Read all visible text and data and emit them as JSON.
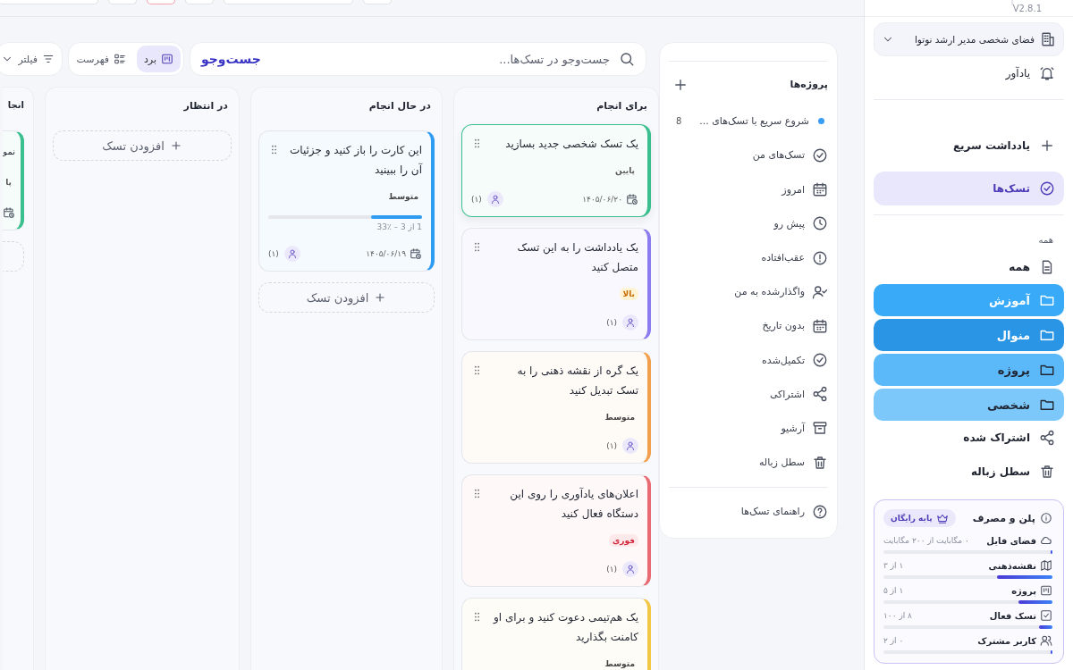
{
  "top_toolbar": {
    "buttons": [
      {
        "kind": "small",
        "selected": false
      },
      {
        "kind": "long",
        "selected": false
      },
      {
        "kind": "small",
        "selected": false
      },
      {
        "kind": "small",
        "selected": true
      },
      {
        "kind": "small",
        "selected": false
      },
      {
        "kind": "wide",
        "selected": false
      }
    ]
  },
  "sidebar": {
    "version": "V2.8.1",
    "workspace": {
      "label": "فضای شخصی مدیر ارشد نوتوا"
    },
    "reminder": {
      "label": "یادآور"
    },
    "nav": [
      {
        "label": "یادداشت سریع",
        "selected": false
      },
      {
        "label": "تسک‌ها",
        "selected": true
      }
    ],
    "section_label": "همه",
    "all_item": {
      "label": "همه"
    },
    "folders": [
      {
        "label": "آموزش",
        "color": "#38aaf8",
        "dark": true
      },
      {
        "label": "منوال",
        "color": "#2a95e5",
        "dark": true
      },
      {
        "label": "پروژه",
        "color": "#5cb9f9",
        "dark": false
      },
      {
        "label": "شخصی",
        "color": "#7cc8fb",
        "dark": false
      }
    ],
    "extra": [
      {
        "label": "اشتراک شده"
      },
      {
        "label": "سطل زباله"
      }
    ],
    "plan": {
      "title": "پلن و مصرف",
      "badge": "پایه رایگان",
      "rows": [
        {
          "label": "فضای فایل",
          "reading": "۰ مگابایت از ۲۰۰ مگابایت",
          "level": 0.01
        },
        {
          "label": "نقشه‌ذهنی",
          "reading": "۱ از ۳",
          "level": 0.33
        },
        {
          "label": "پروژه",
          "reading": "۱ از ۵",
          "level": 0.2
        },
        {
          "label": "تسک فعال",
          "reading": "۸ از ۱۰۰",
          "level": 0.08
        },
        {
          "label": "کاربر مشترک",
          "reading": "۰ از ۲",
          "level": 0
        }
      ]
    }
  },
  "projects_panel": {
    "title": "پروژه‌ها",
    "projects": [
      {
        "label": "شروع سریع با تسک‌های ...",
        "count": "8",
        "color": "#3b9ef5"
      }
    ],
    "views": [
      {
        "label": "تسک‌های من"
      },
      {
        "label": "امروز"
      },
      {
        "label": "پیش رو"
      },
      {
        "label": "عقب‌افتاده"
      },
      {
        "label": "واگذارشده به من"
      },
      {
        "label": "بدون تاریخ"
      },
      {
        "label": "تکمیل‌شده"
      },
      {
        "label": "اشتراکی"
      },
      {
        "label": "آرشیو"
      },
      {
        "label": "سطل زباله"
      }
    ],
    "help": "راهنمای تسک‌ها"
  },
  "toolbar": {
    "search": {
      "placeholder": "جست‌وجو در تسک‌ها...",
      "button": "جست‌وجو"
    },
    "views": [
      {
        "label": "برد",
        "selected": true
      },
      {
        "label": "فهرست",
        "selected": false
      }
    ],
    "filter": "فیلتر"
  },
  "columns": [
    {
      "kind": "full",
      "title": "برای انجام",
      "cards": [
        {
          "title": "یک تسک شخصی جدید بسازید",
          "tag": {
            "label": "پایین",
            "kind": "low"
          },
          "color": "#3cbf8f",
          "selected": true,
          "date": "۱۴۰۵/۰۶/۲۰",
          "assignees": "(۱)"
        },
        {
          "title": "یک یادداشت را به این تسک متصل کنید",
          "tag": {
            "label": "بالا",
            "kind": "high"
          },
          "color": "#8b7cf0",
          "selected": false,
          "assignees": "(۱)"
        },
        {
          "title": "یک گره از نقشه ذهنی را به تسک تبدیل کنید",
          "tag": {
            "label": "متوسط",
            "kind": "medium"
          },
          "color": "#f2a04e",
          "selected": false,
          "assignees": "(۱)"
        },
        {
          "title": "اعلان‌های یادآوری را روی این دستگاه فعال کنید",
          "tag": {
            "label": "فوری",
            "kind": "urgent"
          },
          "color": "#ea6a74",
          "selected": false,
          "assignees": "(۱)"
        },
        {
          "title": "یک هم‌تیمی دعوت کنید و برای او کامنت بگذارید",
          "tag": {
            "label": "متوسط",
            "kind": "medium"
          },
          "color": "#f1c745",
          "selected": false
        }
      ]
    },
    {
      "kind": "full",
      "title": "در حال انجام",
      "add": "افزودن تسک",
      "cards": [
        {
          "title": "این کارت را باز کنید و جزئیات آن را ببینید",
          "tag": {
            "label": "متوسط",
            "kind": "medium"
          },
          "color": "#2f9cf3",
          "selected": false,
          "progress": {
            "level": 0.33,
            "reading": "1 از 3 – ٪33"
          },
          "date": "۱۴۰۵/۰۶/۱۹",
          "assignees": "(۱)"
        }
      ]
    },
    {
      "kind": "full",
      "title": "در انتظار",
      "add": "افزودن تسک"
    },
    {
      "kind": "partial",
      "title": "انجا",
      "cards": [
        {
          "title": "نمو",
          "tag": {
            "label": "پا",
            "kind": "low"
          },
          "color": "#3cbf8f",
          "selected": false
        }
      ]
    }
  ]
}
